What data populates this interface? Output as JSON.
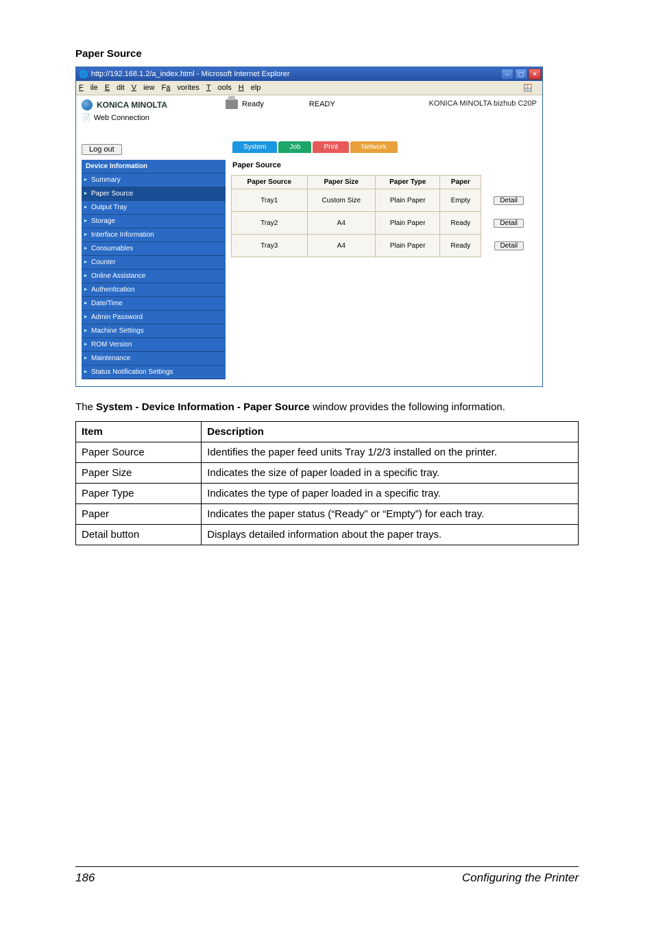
{
  "sectionTitle": "Paper Source",
  "ie": {
    "title": "http://192.168.1.2/a_index.html - Microsoft Internet Explorer",
    "menus": [
      "File",
      "Edit",
      "View",
      "Favorites",
      "Tools",
      "Help"
    ]
  },
  "header": {
    "brand": "KONICA MINOLTA",
    "pagescope": "Web Connection",
    "statusLabel": "Ready",
    "statusUpper": "READY",
    "model": "KONICA MINOLTA bizhub C20P",
    "logout": "Log out"
  },
  "tabs": {
    "system": "System",
    "job": "Job",
    "print": "Print",
    "network": "Network"
  },
  "sidebar": {
    "header": "Device Information",
    "items": {
      "summary": "Summary",
      "papersource": "Paper Source",
      "output": "Output Tray",
      "storage": "Storage",
      "interface": "Interface Information",
      "consumables": "Consumables",
      "counter": "Counter",
      "online": "Online Assistance",
      "auth": "Authentication",
      "datetime": "Date/Time",
      "admin": "Admin Password",
      "machine": "Machine Settings",
      "rom": "ROM Version",
      "maint": "Maintenance",
      "statusnotif": "Status Notification Settings"
    }
  },
  "content": {
    "title": "Paper Source",
    "cols": {
      "src": "Paper Source",
      "size": "Paper Size",
      "type": "Paper Type",
      "paper": "Paper"
    },
    "rows": [
      {
        "src": "Tray1",
        "size": "Custom Size",
        "type": "Plain Paper",
        "paper": "Empty",
        "btn": "Detail"
      },
      {
        "src": "Tray2",
        "size": "A4",
        "type": "Plain Paper",
        "paper": "Ready",
        "btn": "Detail"
      },
      {
        "src": "Tray3",
        "size": "A4",
        "type": "Plain Paper",
        "paper": "Ready",
        "btn": "Detail"
      }
    ]
  },
  "bodyText": {
    "prefix": "The ",
    "bold": "System - Device Information - Paper Source",
    "suffix": " window provides the following information."
  },
  "descTable": {
    "header": {
      "item": "Item",
      "desc": "Description"
    },
    "rows": [
      {
        "item": "Paper Source",
        "desc": "Identifies the paper feed units Tray 1/2/3 installed on the printer."
      },
      {
        "item": "Paper Size",
        "desc": "Indicates the size of paper loaded in a specific tray."
      },
      {
        "item": "Paper Type",
        "desc": "Indicates the type of paper loaded in a specific tray."
      },
      {
        "item": "Paper",
        "desc": "Indicates the paper status (“Ready” or “Empty”) for each tray."
      },
      {
        "item": "Detail button",
        "desc": "Displays detailed information about the paper trays."
      }
    ]
  },
  "footer": {
    "page": "186",
    "title": "Configuring the Printer"
  }
}
